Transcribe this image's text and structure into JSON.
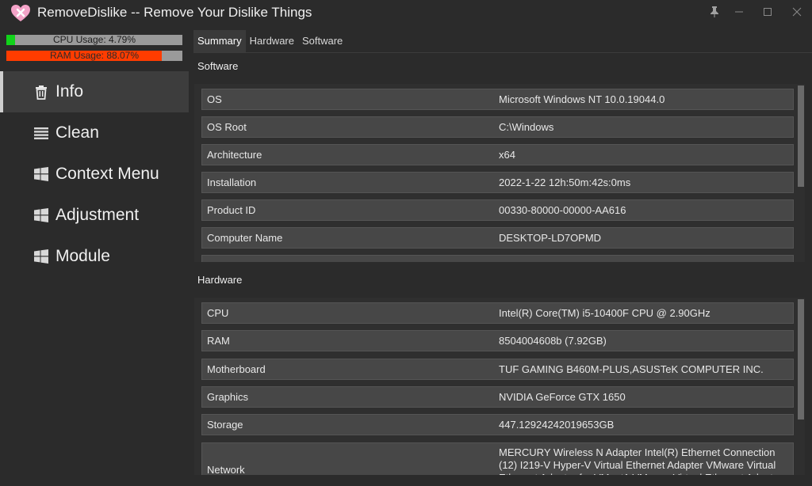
{
  "window": {
    "title": "RemoveDislike -- Remove Your Dislike Things",
    "icon": "heart-x-icon",
    "controls": [
      "pin-icon",
      "minimize-icon",
      "maximize-icon",
      "close-icon"
    ]
  },
  "meters": {
    "cpu": {
      "label": "CPU Usage: 4.79%",
      "percent": 4.79,
      "color": "#11d31a"
    },
    "ram": {
      "label": "RAM Usage: 88.07%",
      "percent": 88.07,
      "color": "#ff3c00"
    }
  },
  "nav": [
    {
      "label": "Info",
      "icon": "trash-icon",
      "active": true
    },
    {
      "label": "Clean",
      "icon": "list-icon",
      "active": false
    },
    {
      "label": "Context Menu",
      "icon": "windows-icon",
      "active": false
    },
    {
      "label": "Adjustment",
      "icon": "windows-icon",
      "active": false
    },
    {
      "label": "Module",
      "icon": "windows-icon",
      "active": false
    }
  ],
  "tabs": [
    {
      "label": "Summary",
      "active": true
    },
    {
      "label": "Hardware",
      "active": false
    },
    {
      "label": "Software",
      "active": false
    }
  ],
  "software": {
    "title": "Software",
    "rows": [
      {
        "key": "OS",
        "value": "Microsoft Windows NT 10.0.19044.0"
      },
      {
        "key": "OS Root",
        "value": "C:\\Windows"
      },
      {
        "key": "Architecture",
        "value": "x64"
      },
      {
        "key": "Installation",
        "value": "2022-1-22 12h:50m:42s:0ms"
      },
      {
        "key": "Product ID",
        "value": "00330-80000-00000-AA616"
      },
      {
        "key": "Computer Name",
        "value": "DESKTOP-LD7OPMD"
      }
    ]
  },
  "hardware": {
    "title": "Hardware",
    "rows": [
      {
        "key": "CPU",
        "value": "Intel(R) Core(TM) i5-10400F CPU @ 2.90GHz"
      },
      {
        "key": "RAM",
        "value": "8504004608b (7.92GB)"
      },
      {
        "key": "Motherboard",
        "value": "TUF GAMING B460M-PLUS,ASUSTeK COMPUTER INC."
      },
      {
        "key": "Graphics",
        "value": "NVIDIA GeForce GTX 1650"
      },
      {
        "key": "Storage",
        "value": "447.12924242019653GB"
      },
      {
        "key": "Network",
        "value": "MERCURY Wireless N Adapter Intel(R) Ethernet Connection (12) I219-V Hyper-V Virtual Ethernet Adapter VMware Virtual Ethernet Adapter for VMnet1 VMware Virtual Ethernet Adapter"
      }
    ]
  }
}
